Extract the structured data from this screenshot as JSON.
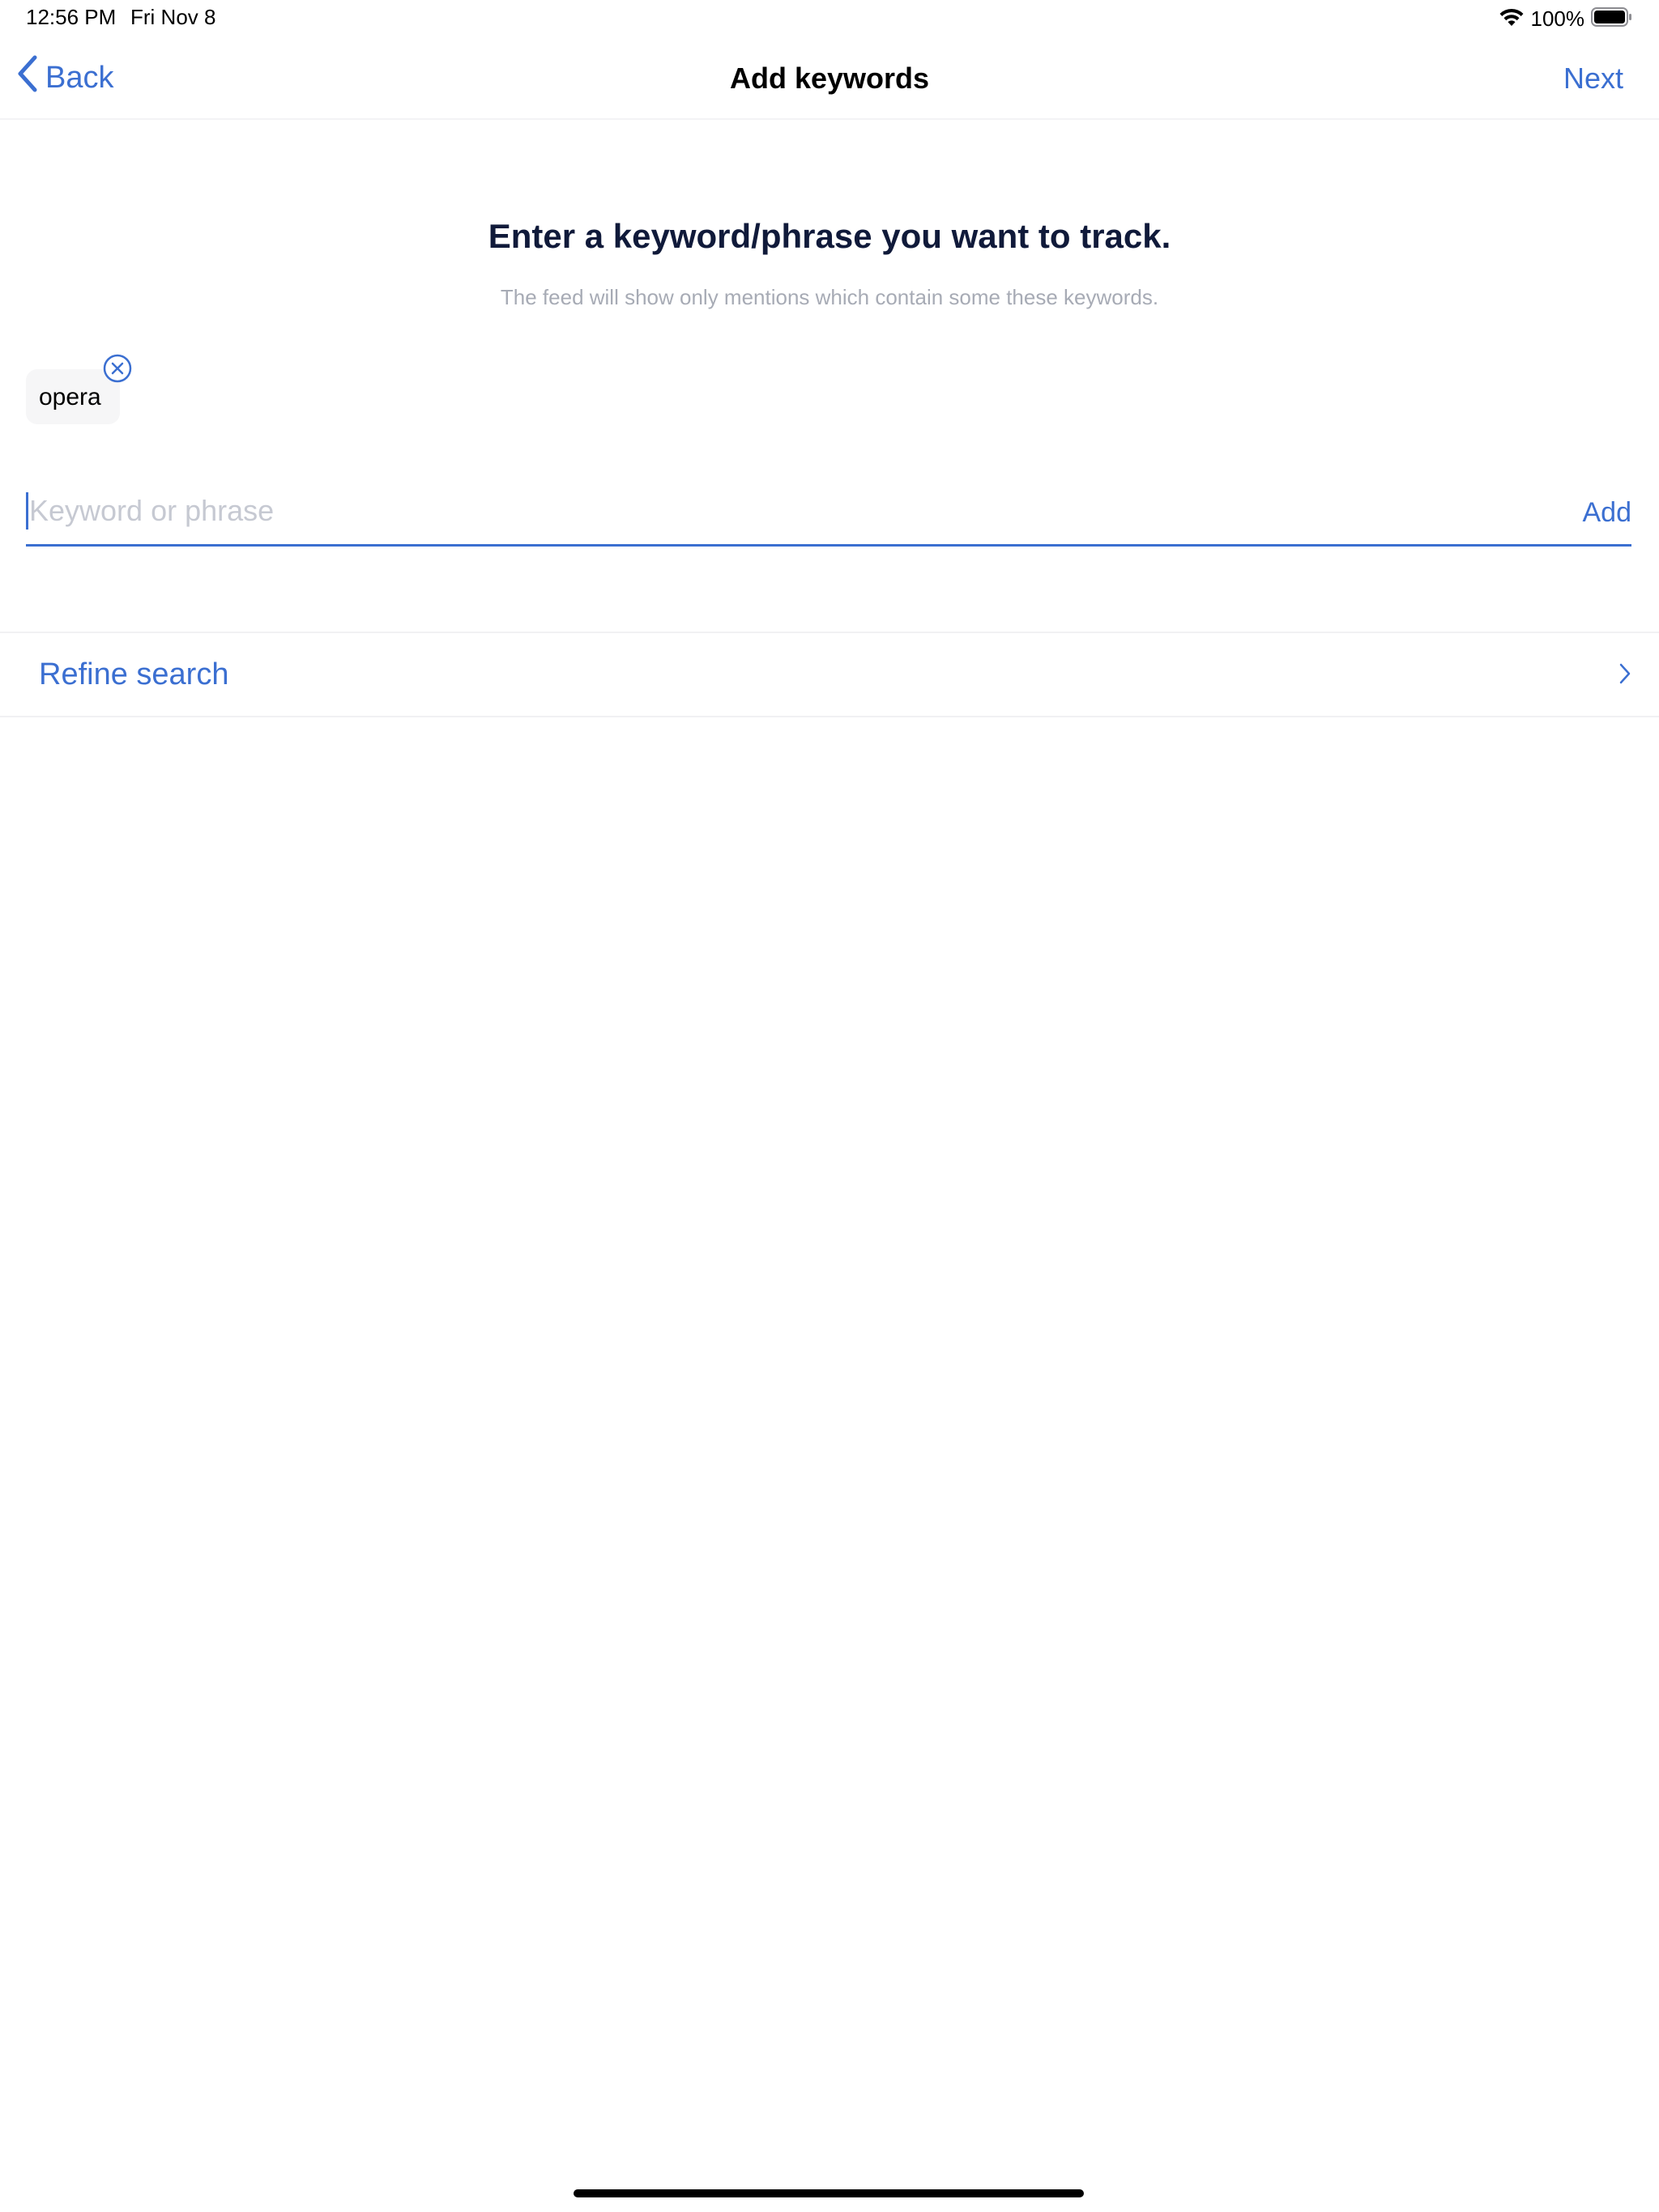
{
  "status_bar": {
    "time": "12:56 PM",
    "date": "Fri Nov 8",
    "battery_percent": "100%",
    "wifi_icon": "wifi-icon",
    "battery_icon": "battery-full-icon"
  },
  "nav": {
    "back_label": "Back",
    "title": "Add keywords",
    "next_label": "Next"
  },
  "content": {
    "heading": "Enter a keyword/phrase you want to track.",
    "subheading": "The feed will show only mentions which contain some these keywords.",
    "keywords": [
      "opera"
    ],
    "input_placeholder": "Keyword or phrase",
    "input_value": "",
    "add_label": "Add",
    "refine_label": "Refine search"
  },
  "colors": {
    "accent": "#3b6fd1",
    "heading": "#101a3a",
    "muted": "#a7abb5"
  }
}
